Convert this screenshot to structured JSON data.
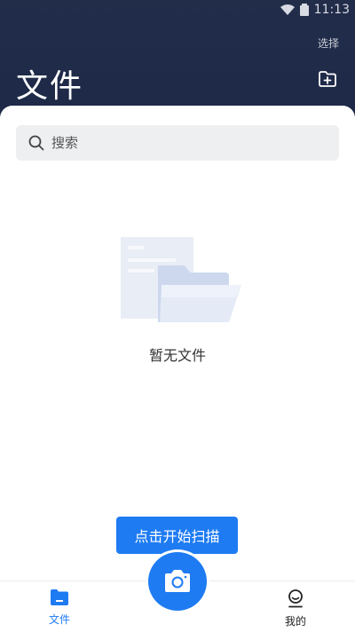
{
  "status_bar": {
    "time": "11:13"
  },
  "header": {
    "title": "文件",
    "select_label": "选择"
  },
  "search": {
    "placeholder": "搜索"
  },
  "empty_state": {
    "text": "暂无文件"
  },
  "scan_tooltip": {
    "text": "点击开始扫描"
  },
  "tabbar": {
    "files_label": "文件",
    "mine_label": "我的"
  },
  "colors": {
    "accent": "#1e7bf2",
    "header_bg": "#1e2a44"
  }
}
